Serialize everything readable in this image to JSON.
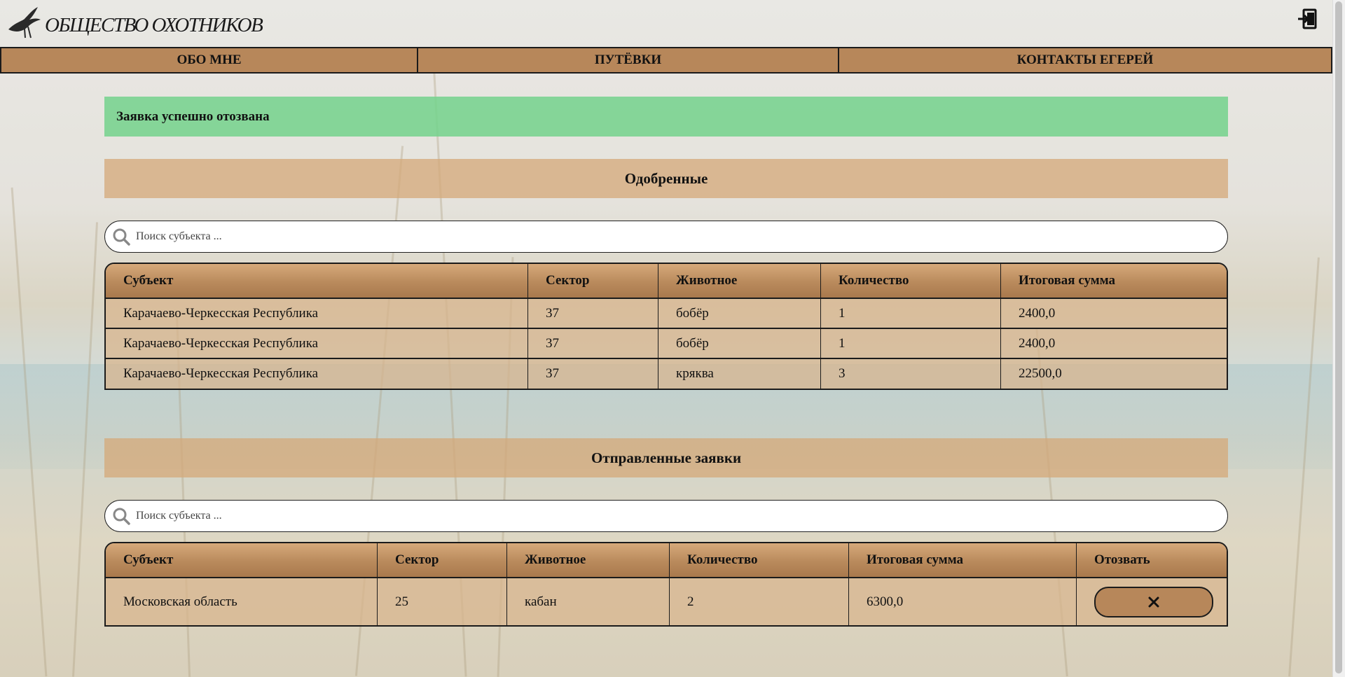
{
  "header": {
    "logo_text": "ОБЩЕСТВО ОХОТНИКОВ",
    "logo_icon": "bird-icon",
    "exit_icon": "logout-icon"
  },
  "nav": {
    "items": [
      {
        "label": "ОБО МНЕ"
      },
      {
        "label": "ПУТЁВКИ"
      },
      {
        "label": "КОНТАКТЫ ЕГЕРЕЙ"
      }
    ]
  },
  "alert": {
    "text": "Заявка успешно отозвана",
    "color": "#7dd395"
  },
  "approved": {
    "title": "Одобренные",
    "search_placeholder": "Поиск субъекта ...",
    "columns": [
      "Субъект",
      "Сектор",
      "Животное",
      "Количество",
      "Итоговая сумма"
    ],
    "rows": [
      [
        "Карачаево-Черкесская Республика",
        "37",
        "бобёр",
        "1",
        "2400,0"
      ],
      [
        "Карачаево-Черкесская Республика",
        "37",
        "бобёр",
        "1",
        "2400,0"
      ],
      [
        "Карачаево-Черкесская Республика",
        "37",
        "кряква",
        "3",
        "22500,0"
      ]
    ]
  },
  "sent": {
    "title": "Отправленные заявки",
    "search_placeholder": "Поиск субъекта ...",
    "columns": [
      "Субъект",
      "Сектор",
      "Животное",
      "Количество",
      "Итоговая сумма",
      "Отозвать"
    ],
    "rows": [
      [
        "Московская область",
        "25",
        "кабан",
        "2",
        "6300,0"
      ]
    ],
    "revoke_icon": "close-icon"
  },
  "colors": {
    "accent": "#b7875a",
    "section_bg": "#d4a878"
  }
}
